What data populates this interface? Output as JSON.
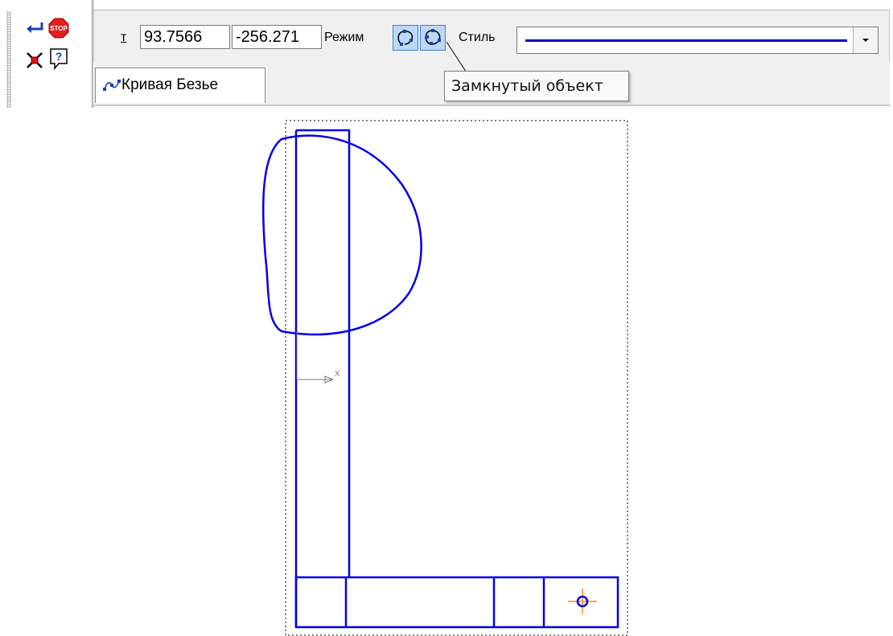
{
  "toolbar": {
    "commands": {
      "apply_icon": "enter-arrow-icon",
      "stop_icon": "stop-sign-icon",
      "stop_text": "STOP",
      "select_icon": "object-select-icon",
      "help_icon": "help-icon",
      "help_glyph": "?"
    },
    "point_label": "т",
    "x_value": "93.7566",
    "y_value": "-256.271",
    "mode_label": "Режим",
    "mode_buttons": [
      {
        "name": "open-curve",
        "icon": "open-bezier-icon"
      },
      {
        "name": "closed-object",
        "icon": "closed-bezier-icon"
      }
    ],
    "style_label": "Стиль",
    "style_line_color": "#0000cc"
  },
  "tab": {
    "label": "Кривая Безье",
    "icon": "bezier-curve-icon"
  },
  "tooltip": {
    "text": "Замкнутый объект"
  },
  "canvas": {
    "axis_label": "X",
    "line_color": "#0000ee",
    "point_marker_color": "#ff8800"
  }
}
